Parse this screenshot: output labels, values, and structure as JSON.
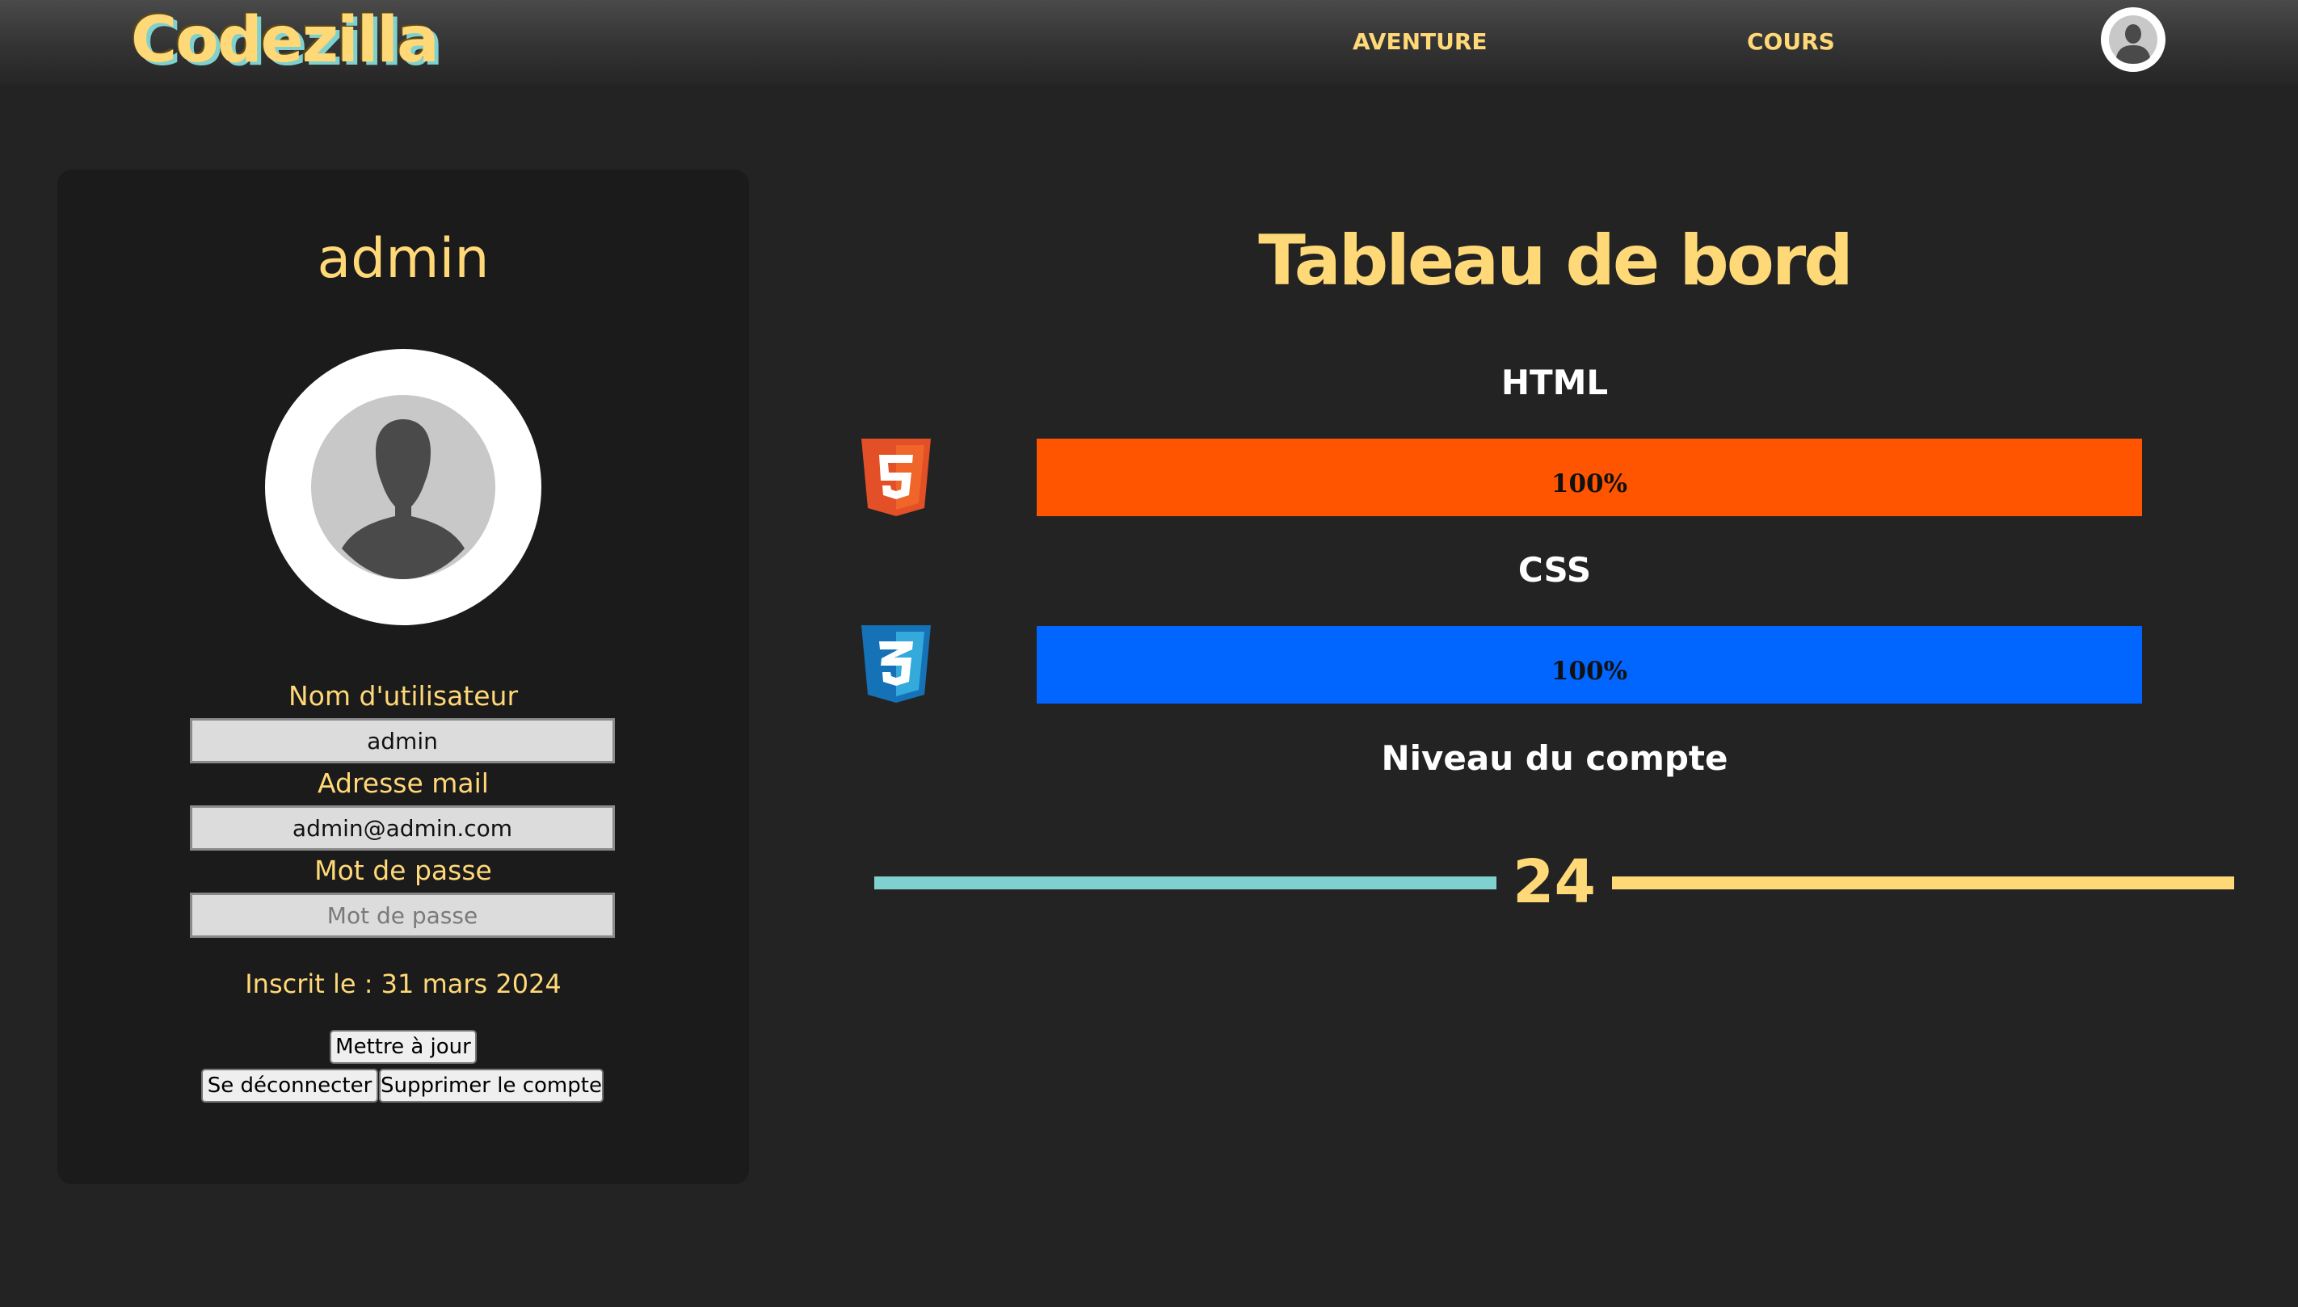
{
  "brand": {
    "logo_text": "Codezilla",
    "logo_color": "#ffd877",
    "logo_shadow_color": "#7fd1cf"
  },
  "nav": {
    "items": [
      {
        "label": "AVENTURE"
      },
      {
        "label": "COURS"
      }
    ],
    "avatar_icon": "user-avatar-icon"
  },
  "profile": {
    "username_display": "admin",
    "avatar_icon": "user-silhouette-icon",
    "fields": {
      "username_label": "Nom d'utilisateur",
      "username_value": "admin",
      "email_label": "Adresse mail",
      "email_value": "admin@admin.com",
      "password_label": "Mot de passe",
      "password_value": "",
      "password_placeholder": "Mot de passe"
    },
    "registered_text": "Inscrit le : 31 mars 2024",
    "buttons": {
      "update": "Mettre à jour",
      "logout": "Se déconnecter",
      "delete": "Supprimer le compte"
    }
  },
  "dashboard": {
    "title": "Tableau de bord",
    "skills": [
      {
        "name": "HTML",
        "icon": "html5-icon",
        "progress": 100,
        "progress_text": "100%",
        "color": "#ff5500"
      },
      {
        "name": "CSS",
        "icon": "css3-icon",
        "progress": 100,
        "progress_text": "100%",
        "color": "#0066ff"
      }
    ],
    "level": {
      "title": "Niveau du compte",
      "value": "24",
      "left_line_color": "#7fd1cf",
      "right_line_color": "#ffd877"
    }
  },
  "colors": {
    "background": "#232323",
    "card": "#1b1b1b",
    "accent": "#ffd877"
  }
}
